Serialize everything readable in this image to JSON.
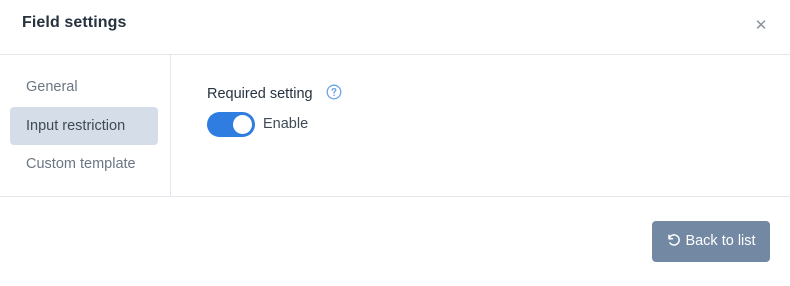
{
  "dialog": {
    "title": "Field settings",
    "close_icon": "close-icon"
  },
  "sidebar": {
    "items": [
      {
        "label": "General",
        "active": false
      },
      {
        "label": "Input restriction",
        "active": true
      },
      {
        "label": "Custom template",
        "active": false
      }
    ]
  },
  "content": {
    "required_setting_label": "Required setting",
    "help_icon": "help-circle-icon",
    "toggle": {
      "state": "on",
      "label": "Enable"
    }
  },
  "footer": {
    "back_button_label": "Back to list",
    "back_icon": "undo-icon"
  },
  "colors": {
    "accent": "#2f7de1",
    "active_nav_bg": "#d4dde8",
    "button_bg": "#7288a3",
    "title_text": "#27323f",
    "muted_text": "#6b7684",
    "border": "#e3e6ea"
  }
}
